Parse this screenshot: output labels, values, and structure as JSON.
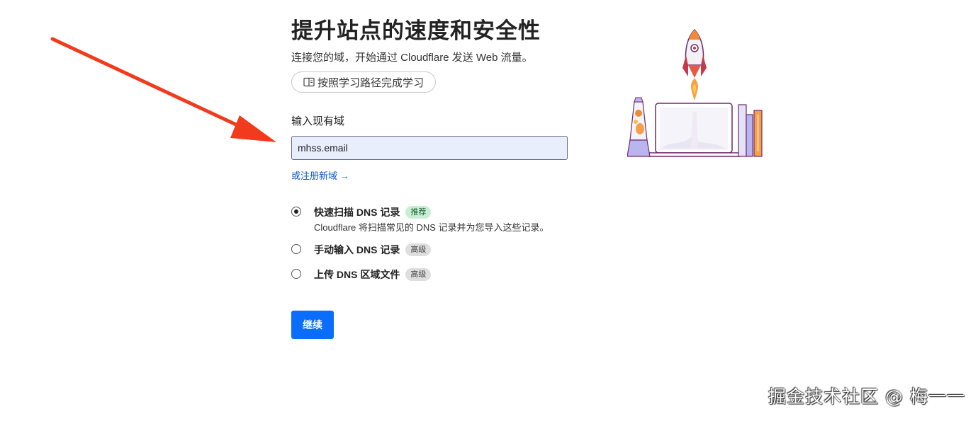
{
  "header": {
    "title": "提升站点的速度和安全性",
    "subtitle": "连接您的域，开始通过 Cloudflare 发送 Web 流量。",
    "learn_button": "按照学习路径完成学习"
  },
  "domain_form": {
    "label": "输入现有域",
    "value": "mhss.email",
    "register_link": "或注册新域",
    "register_arrow": "→"
  },
  "dns_options": [
    {
      "label": "快速扫描 DNS 记录",
      "badge": "推荐",
      "description": "Cloudflare 将扫描常见的 DNS 记录并为您导入这些记录。",
      "checked": true
    },
    {
      "label": "手动输入 DNS 记录",
      "badge": "高级",
      "checked": false
    },
    {
      "label": "上传 DNS 区域文件",
      "badge": "高级",
      "checked": false
    }
  ],
  "actions": {
    "continue_label": "继续"
  },
  "watermark": "掘金技术社区 @ 梅一一",
  "colors": {
    "primary_button": "#0a6dfc",
    "link": "#0f57c2",
    "badge_recommended_bg": "#c8efd4",
    "badge_advanced_bg": "#dedede",
    "input_bg": "#e8eefc",
    "annotation_arrow": "#f23a1c"
  },
  "icons": {
    "learn_button_icon": "book-icon",
    "annotation": "red-arrow-annotation",
    "illustration": "rocket-laptop-illustration"
  }
}
